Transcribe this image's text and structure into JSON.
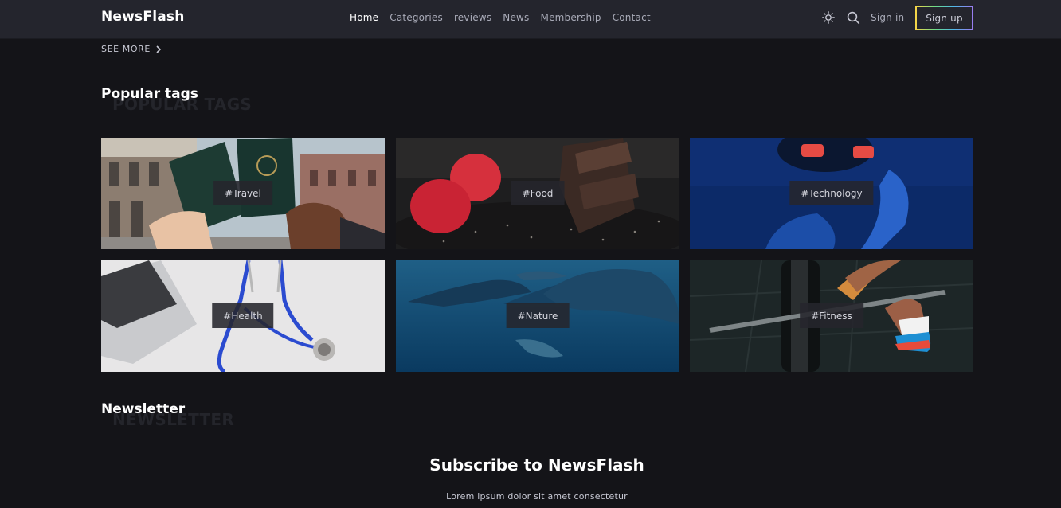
{
  "header": {
    "brand": "NewsFlash",
    "nav": [
      "Home",
      "Categories",
      "reviews",
      "News",
      "Membership",
      "Contact"
    ],
    "signin": "Sign in",
    "signup": "Sign up"
  },
  "see_more": "SEE MORE",
  "popular": {
    "title": "Popular tags",
    "ghost": "POPULAR TAGS",
    "tags": [
      "#Travel",
      "#Food",
      "#Technology",
      "#Health",
      "#Nature",
      "#Fitness"
    ]
  },
  "newsletter": {
    "title": "Newsletter",
    "ghost": "NEWSLETTER",
    "heading": "Subscribe to NewsFlash",
    "text": "Lorem ipsum dolor sit amet consectetur"
  }
}
